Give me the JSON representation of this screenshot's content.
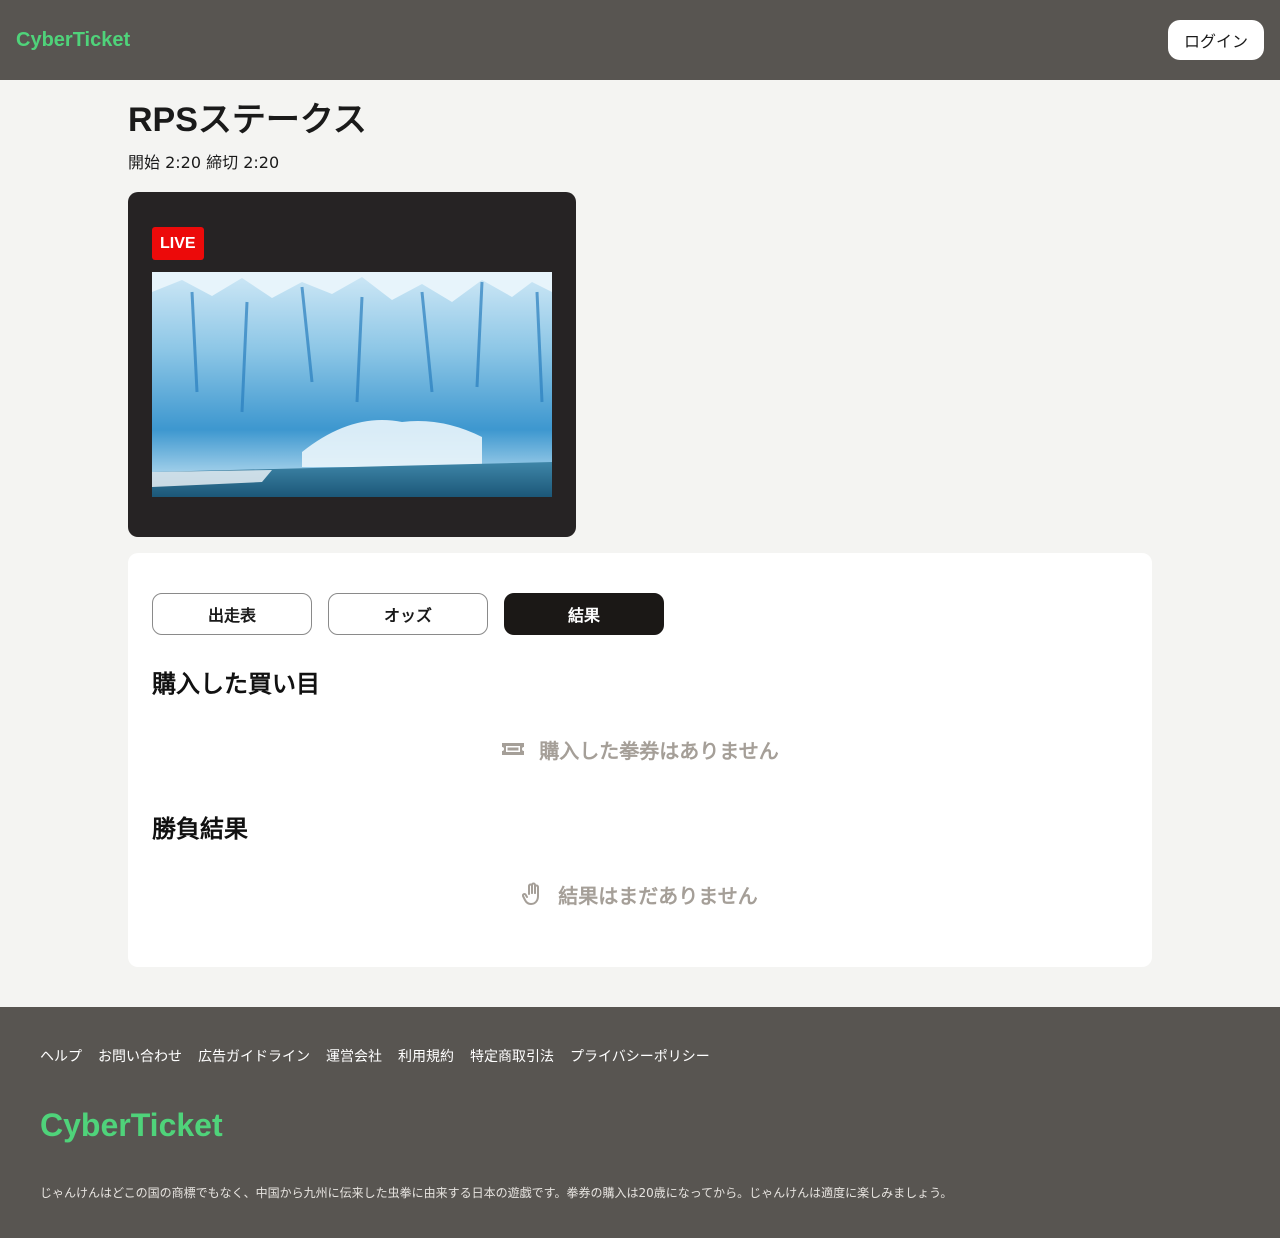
{
  "header": {
    "logo": "CyberTicket",
    "login_label": "ログイン"
  },
  "race": {
    "title": "RPSステークス",
    "times": "開始 2:20 締切 2:20"
  },
  "video": {
    "live_label": "LIVE"
  },
  "tabs": [
    {
      "label": "出走表",
      "active": false
    },
    {
      "label": "オッズ",
      "active": false
    },
    {
      "label": "結果",
      "active": true
    }
  ],
  "purchases": {
    "title": "購入した買い目",
    "empty_text": "購入した拳券はありません",
    "icon": "ticket-icon"
  },
  "results": {
    "title": "勝負結果",
    "empty_text": "結果はまだありません",
    "icon": "hand-icon"
  },
  "footer": {
    "links": [
      "ヘルプ",
      "お問い合わせ",
      "広告ガイドライン",
      "運営会社",
      "利用規約",
      "特定商取引法",
      "プライバシーポリシー"
    ],
    "logo": "CyberTicket",
    "note": "じゃんけんはどこの国の商標でもなく、中国から九州に伝来した虫拳に由来する日本の遊戯です。拳券の購入は20歳になってから。じゃんけんは適度に楽しみましょう。"
  },
  "colors": {
    "header_bg": "#585551",
    "brand_green": "#4fd37a",
    "live_red": "#ec0a0a",
    "tab_active_bg": "#1b1816",
    "empty_text": "#a59f98"
  }
}
